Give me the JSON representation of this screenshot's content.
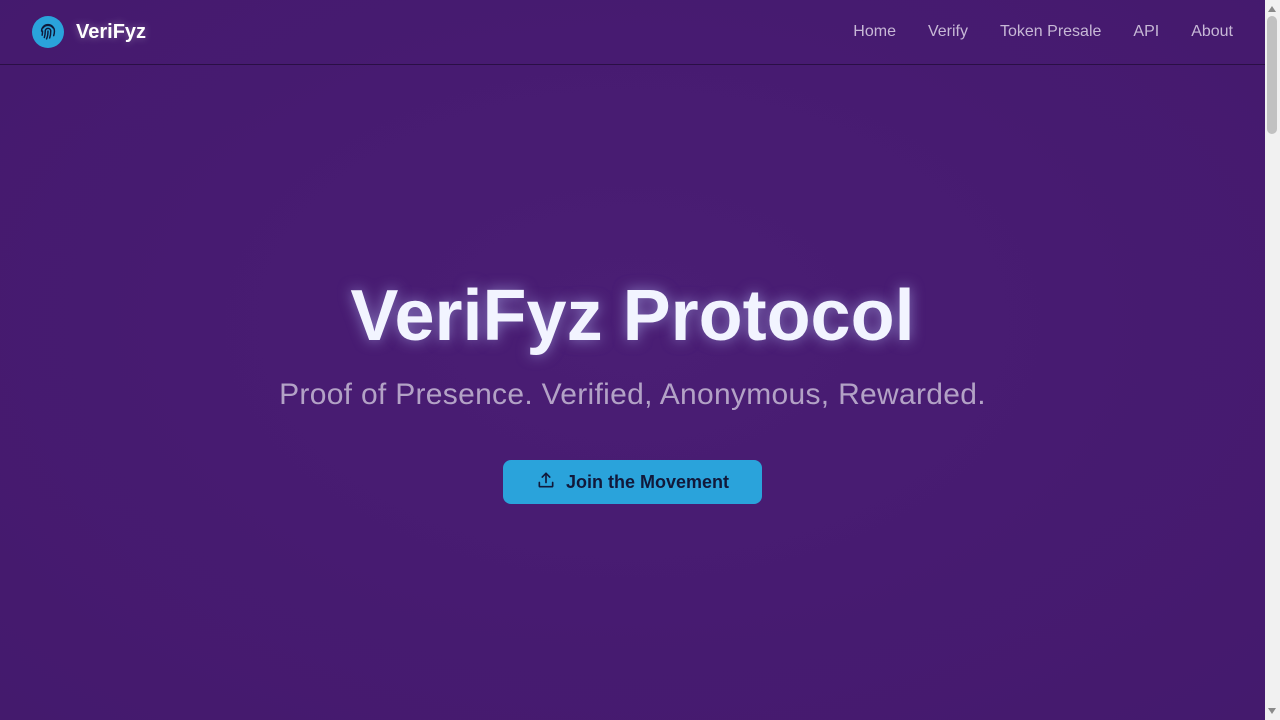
{
  "brand": {
    "name": "VeriFyz",
    "logo_icon": "fingerprint-icon"
  },
  "nav": {
    "items": [
      {
        "label": "Home"
      },
      {
        "label": "Verify"
      },
      {
        "label": "Token Presale"
      },
      {
        "label": "API"
      },
      {
        "label": "About"
      }
    ]
  },
  "hero": {
    "title": "VeriFyz Protocol",
    "subtitle": "Proof of Presence. Verified, Anonymous, Rewarded.",
    "cta_label": "Join the Movement",
    "cta_icon": "upload-icon"
  },
  "colors": {
    "background": "#461b70",
    "accent": "#2aa3db",
    "title": "#f2f4ff",
    "subtitle": "#b3a2c6",
    "nav_text": "#c7b8d6"
  }
}
